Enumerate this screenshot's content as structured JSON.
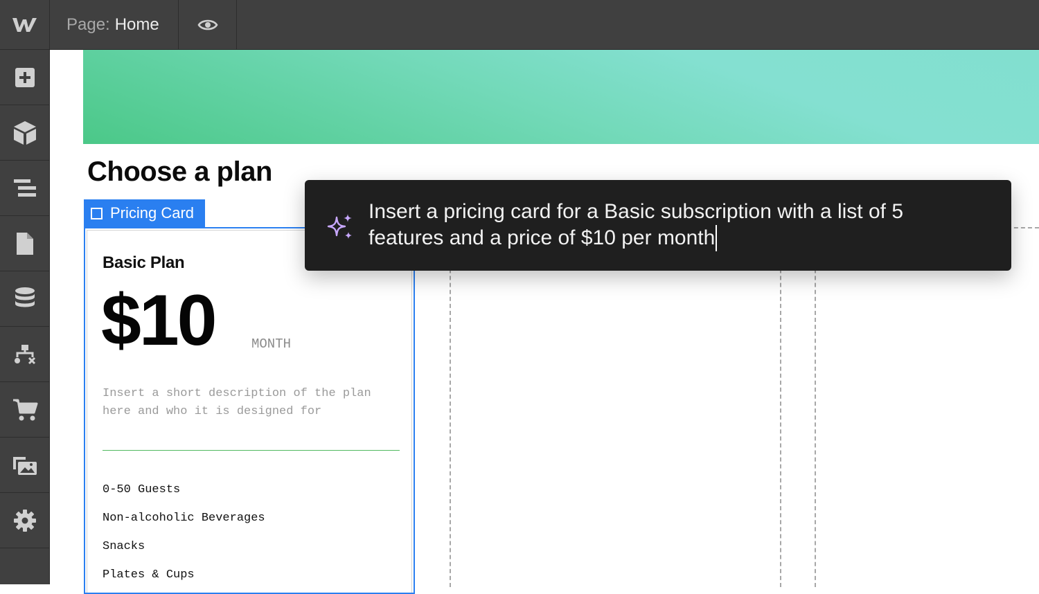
{
  "topbar": {
    "page_label": "Page:",
    "page_name": "Home"
  },
  "sidebar": {
    "items": [
      "add-icon",
      "cube-icon",
      "navigator-icon",
      "pages-icon",
      "cms-icon",
      "logic-icon",
      "ecommerce-icon",
      "assets-icon",
      "settings-icon"
    ]
  },
  "canvas": {
    "heading": "Choose a plan",
    "selected_element_label": "Pricing Card",
    "card": {
      "plan_name": "Basic Plan",
      "price": "$10",
      "period": "MONTH",
      "description": "Insert a short description of the plan here and who it is designed for",
      "features": [
        "0-50 Guests",
        "Non-alcoholic Beverages",
        "Snacks",
        "Plates & Cups"
      ]
    }
  },
  "ai_prompt": {
    "text": "Insert a pricing card for a Basic subscription with a list of 5 features and a price of $10 per month"
  },
  "colors": {
    "selection_blue": "#2a7ff0",
    "sparkle_purple": "#c8a8ff",
    "divider_green": "#4fb85e"
  }
}
